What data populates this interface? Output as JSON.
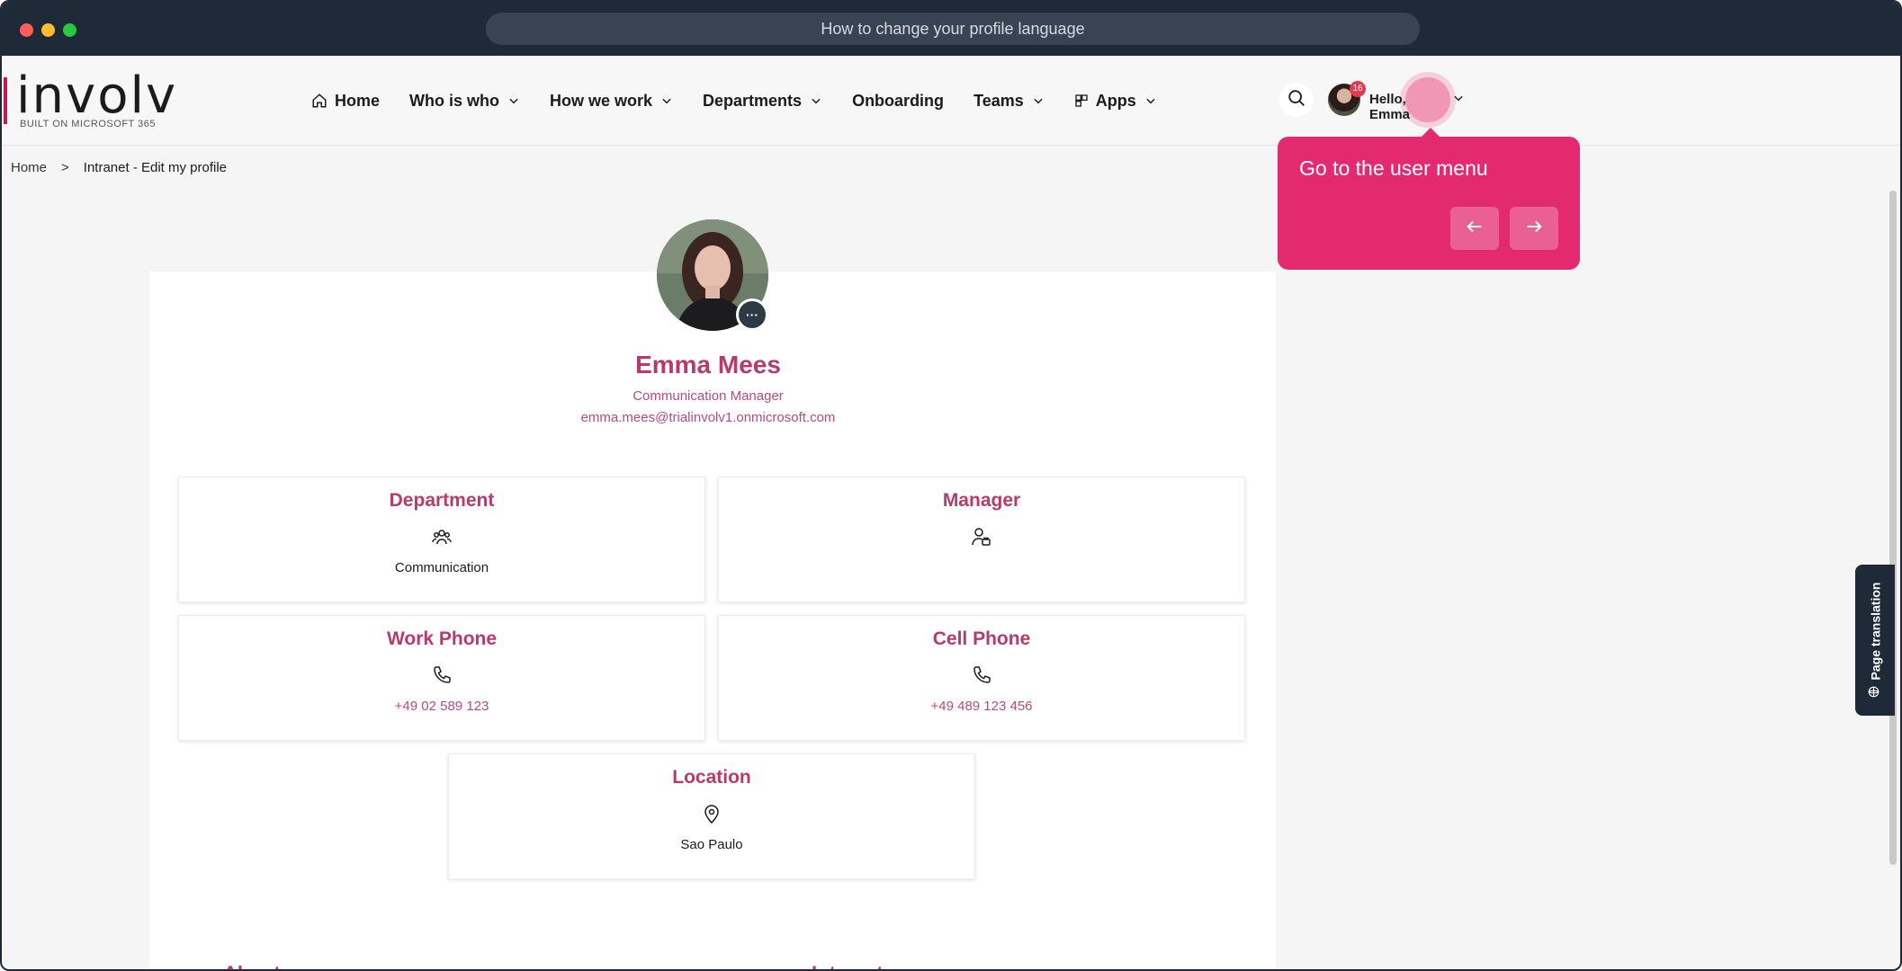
{
  "browser": {
    "tab_title": "How to change your profile language"
  },
  "brand": {
    "logo_text": "involv",
    "logo_subtitle": "BUILT ON MICROSOFT 365",
    "accent_color": "#b83a6b"
  },
  "nav": {
    "items": [
      {
        "label": "Home",
        "icon": "home-icon",
        "has_dropdown": false
      },
      {
        "label": "Who is who",
        "has_dropdown": true
      },
      {
        "label": "How we work",
        "has_dropdown": true
      },
      {
        "label": "Departments",
        "has_dropdown": true
      },
      {
        "label": "Onboarding",
        "has_dropdown": false
      },
      {
        "label": "Teams",
        "has_dropdown": true
      },
      {
        "label": "Apps",
        "icon": "apps-icon",
        "has_dropdown": true
      }
    ],
    "notification_count": "16",
    "greeting": "Hello, Emma"
  },
  "tooltip": {
    "text": "Go to the user menu"
  },
  "breadcrumb": {
    "home": "Home",
    "separator": ">",
    "current": "Intranet - Edit my profile"
  },
  "profile": {
    "name": "Emma Mees",
    "job_title": "Communication Manager",
    "email": "emma.mees@trialinvolv1.onmicrosoft.com",
    "more_label": "···"
  },
  "cards": {
    "department": {
      "title": "Department",
      "value": "Communication"
    },
    "manager": {
      "title": "Manager",
      "value": ""
    },
    "work_phone": {
      "title": "Work Phone",
      "value": "+49 02 589 123"
    },
    "cell_phone": {
      "title": "Cell Phone",
      "value": "+49 489 123 456"
    },
    "location": {
      "title": "Location",
      "value": "Sao Paulo"
    }
  },
  "sections": {
    "about_me": "About me",
    "interests": "Interests"
  },
  "page_translation": {
    "label": "Page translation"
  }
}
